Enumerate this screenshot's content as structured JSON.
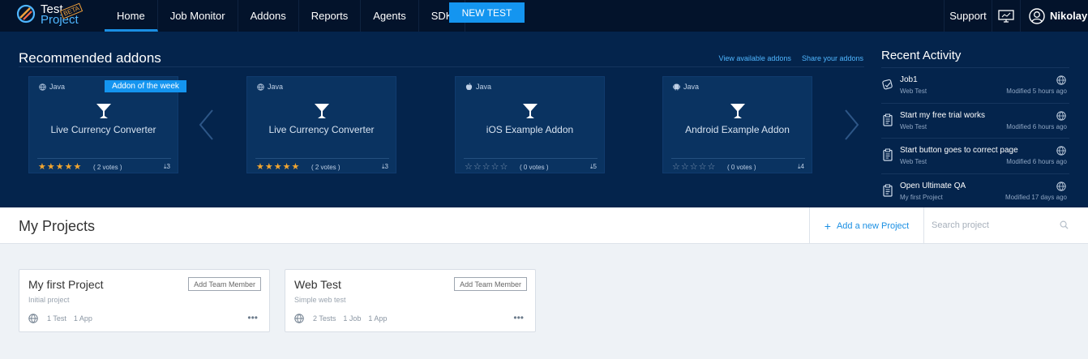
{
  "logo": {
    "line1": "Test",
    "line2": "Project",
    "badge": "BETA"
  },
  "nav": {
    "items": [
      {
        "label": "Home",
        "active": true
      },
      {
        "label": "Job Monitor"
      },
      {
        "label": "Addons"
      },
      {
        "label": "Reports"
      },
      {
        "label": "Agents"
      },
      {
        "label": "SDK"
      }
    ],
    "new_test": "NEW TEST",
    "support": "Support",
    "user": "Nikolay"
  },
  "recommended": {
    "title": "Recommended addons",
    "link_view": "View available addons",
    "link_share": "Share your addons",
    "ribbon": "Addon of the week",
    "cards": [
      {
        "platform": "Java",
        "platform_icon": "globe-icon",
        "name": "Live Currency Converter",
        "stars": "★★★★★",
        "votes": "( 2 votes )",
        "downloads": "3",
        "rating": 5
      },
      {
        "platform": "Java",
        "platform_icon": "globe-icon",
        "name": "Live Currency Converter",
        "stars": "★★★★★",
        "votes": "( 2 votes )",
        "downloads": "3",
        "rating": 5
      },
      {
        "platform": "Java",
        "platform_icon": "apple-icon",
        "name": "iOS Example Addon",
        "stars": "☆☆☆☆☆",
        "votes": "( 0 votes )",
        "downloads": "5",
        "rating": 0
      },
      {
        "platform": "Java",
        "platform_icon": "android-icon",
        "name": "Android Example Addon",
        "stars": "☆☆☆☆☆",
        "votes": "( 0 votes )",
        "downloads": "4",
        "rating": 0
      }
    ]
  },
  "activity": {
    "title": "Recent Activity",
    "items": [
      {
        "title": "Job1",
        "project": "Web Test",
        "modified": "Modified 5 hours ago"
      },
      {
        "title": "Start my free trial works",
        "project": "Web Test",
        "modified": "Modified 6 hours ago"
      },
      {
        "title": "Start button goes to correct page",
        "project": "Web Test",
        "modified": "Modified 6 hours ago"
      },
      {
        "title": "Open Ultimate QA",
        "project": "My first Project",
        "modified": "Modified 17 days ago"
      }
    ]
  },
  "projects": {
    "title": "My Projects",
    "add_label": "Add a new Project",
    "search_placeholder": "Search project",
    "add_member": "Add Team Member",
    "more": "•••",
    "list": [
      {
        "name": "My first Project",
        "desc": "Initial project",
        "stats": [
          "1 Test",
          "1 App"
        ]
      },
      {
        "name": "Web Test",
        "desc": "Simple web test",
        "stats": [
          "2 Tests",
          "1 Job",
          "1 App"
        ]
      }
    ]
  },
  "colors": {
    "nav_bg": "#03132b",
    "band_bg": "#04244c",
    "card_bg": "#0a3361",
    "accent": "#1495f0",
    "star": "#f2a630"
  }
}
